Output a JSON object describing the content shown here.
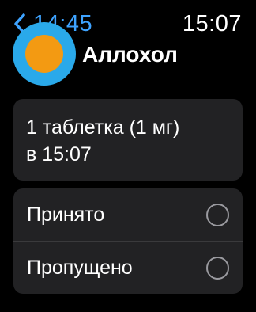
{
  "status_bar": {
    "back_label": "14:45",
    "time": "15:07"
  },
  "medication": {
    "name": "Аллохол",
    "icon": "pill-circle-icon"
  },
  "dose": {
    "line1": "1 таблетка (1 мг)",
    "line2": "в 15:07"
  },
  "options": [
    {
      "label": "Принято",
      "selected": false
    },
    {
      "label": "Пропущено",
      "selected": false
    }
  ],
  "colors": {
    "accent": "#3ea3ff",
    "card": "#222224",
    "pill_outer": "#2aa9ea",
    "pill_inner": "#f39a12"
  }
}
